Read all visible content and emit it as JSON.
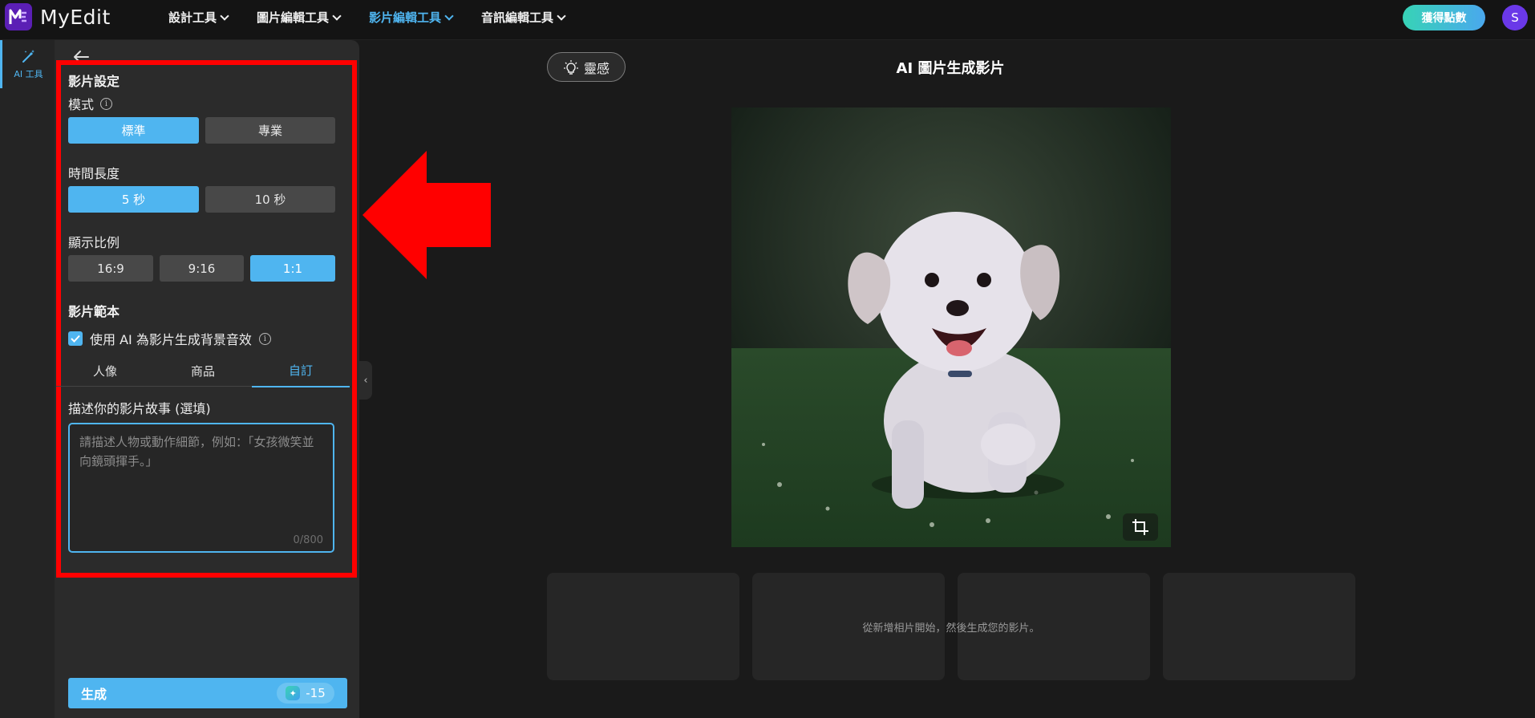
{
  "app": {
    "name": "MyEdit"
  },
  "nav": [
    {
      "label": "設計工具",
      "active": false
    },
    {
      "label": "圖片編輯工具",
      "active": false
    },
    {
      "label": "影片編輯工具",
      "active": true
    },
    {
      "label": "音訊編輯工具",
      "active": false
    }
  ],
  "header": {
    "points_button": "獲得點數",
    "avatar_initial": "S"
  },
  "rail": {
    "ai_tools_label": "AI 工具"
  },
  "settings": {
    "section_title": "影片設定",
    "mode": {
      "label": "模式",
      "options": [
        "標準",
        "專業"
      ],
      "selected": "標準"
    },
    "duration": {
      "label": "時間長度",
      "options": [
        "5 秒",
        "10 秒"
      ],
      "selected": "5 秒"
    },
    "ratio": {
      "label": "顯示比例",
      "options": [
        "16:9",
        "9:16",
        "1:1"
      ],
      "selected": "1:1"
    },
    "template": {
      "section_title": "影片範本",
      "bg_audio_checkbox": "使用 AI 為影片生成背景音效",
      "bg_audio_checked": true,
      "tabs": [
        "人像",
        "商品",
        "自訂"
      ],
      "selected_tab": "自訂"
    },
    "story": {
      "label": "描述你的影片故事 (選填)",
      "placeholder": "請描述人物或動作細節，例如：「女孩微笑並向鏡頭揮手。」",
      "value": "",
      "counter": "0/800"
    },
    "generate": {
      "label": "生成",
      "cost": "-15"
    }
  },
  "main": {
    "inspiration_button": "靈感",
    "title": "AI 圖片生成影片",
    "empty_message": "從新增相片開始，然後生成您的影片。"
  },
  "colors": {
    "accent": "#4fb5f0",
    "highlight_box": "#ff0000",
    "brand": "#5b1fb5"
  }
}
